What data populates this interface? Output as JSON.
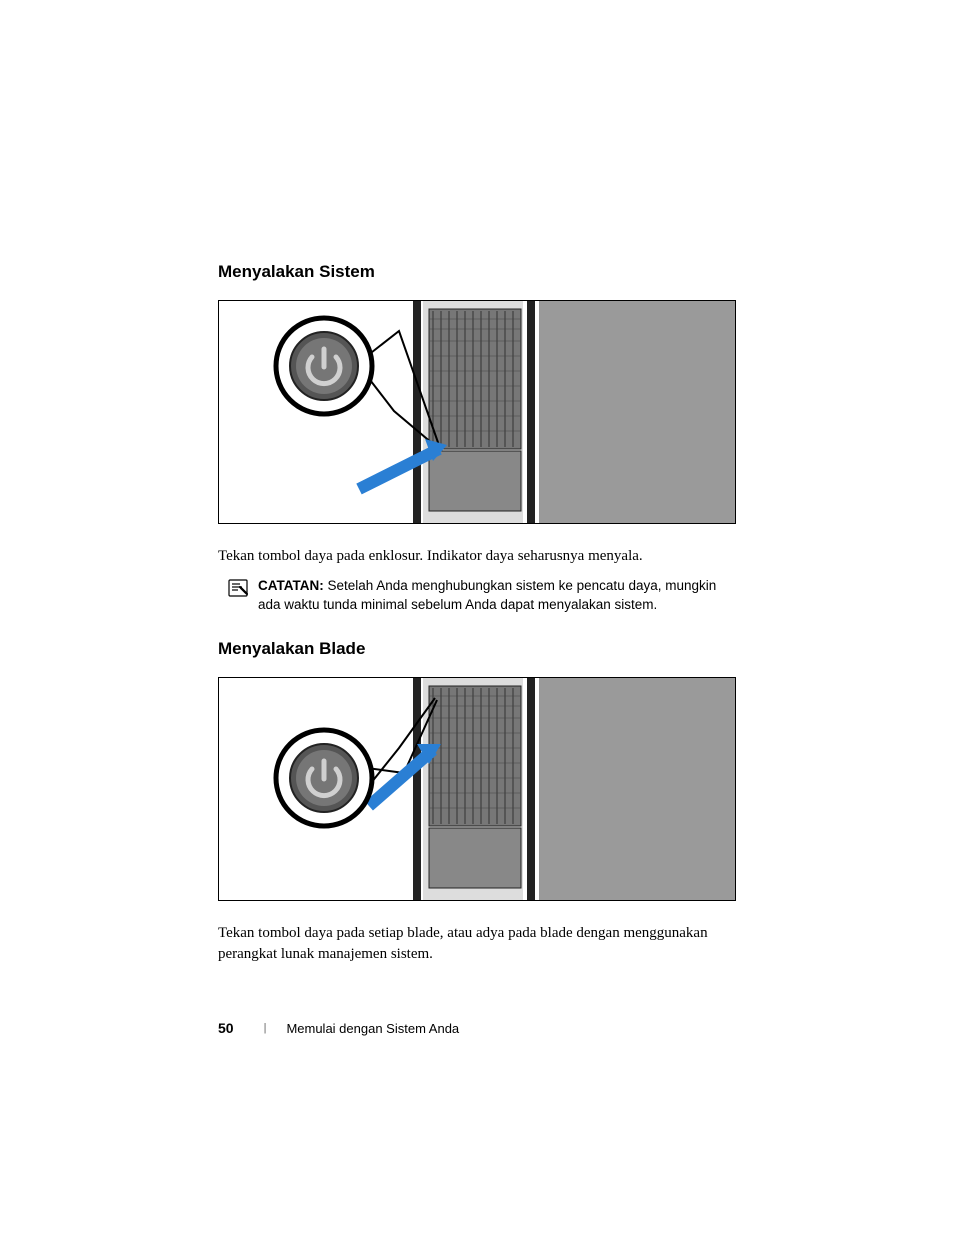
{
  "section1": {
    "heading": "Menyalakan Sistem",
    "body": "Tekan tombol daya pada enklosur. Indikator daya seharusnya menyala."
  },
  "note": {
    "label": "CATATAN:",
    "text": " Setelah Anda menghubungkan sistem ke pencatu daya, mungkin ada waktu tunda minimal sebelum Anda dapat menyalakan sistem."
  },
  "section2": {
    "heading": "Menyalakan Blade",
    "body": "Tekan tombol daya pada setiap blade, atau adya pada blade dengan menggunakan perangkat lunak manajemen sistem."
  },
  "footer": {
    "page_number": "50",
    "title": "Memulai dengan Sistem Anda"
  }
}
